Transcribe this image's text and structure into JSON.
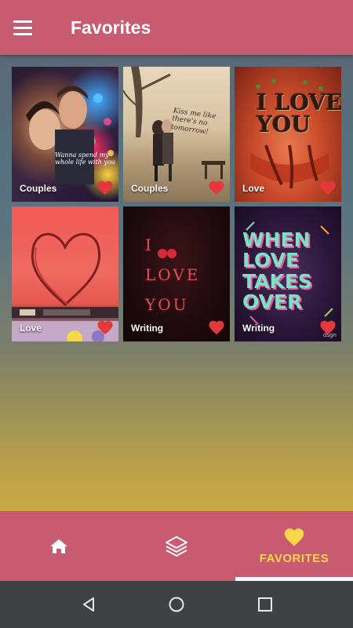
{
  "appbar": {
    "title": "Favorites",
    "menu_icon": "hamburger-menu-icon"
  },
  "cards": [
    {
      "category": "Couples",
      "art_text": "Wanna spend my\nwhole life with you"
    },
    {
      "category": "Couples",
      "art_text": "Kiss me like\nthere's no\ntomorrow!"
    },
    {
      "category": "Love",
      "art_text": "I LOVE\nYOU"
    },
    {
      "category": "Love",
      "art_text": ""
    },
    {
      "category": "Writing",
      "art_text_1": "I",
      "art_text_2": "LOVE",
      "art_text_3": "YOU"
    },
    {
      "category": "Writing",
      "art_text": "WHEN\nLOVE\nTAKES\nOVER",
      "brand": "dsgn"
    }
  ],
  "bottom_nav": {
    "items": [
      {
        "icon": "home-icon",
        "label": ""
      },
      {
        "icon": "layers-icon",
        "label": ""
      },
      {
        "icon": "heart-icon",
        "label": "FAVORITES"
      }
    ],
    "active_color": "#f8d64c"
  },
  "colors": {
    "primary": "#c95b70",
    "heart": "#e5383b",
    "accent": "#f8d64c"
  },
  "system_nav": [
    "back-icon",
    "home-circle-icon",
    "recents-icon"
  ]
}
